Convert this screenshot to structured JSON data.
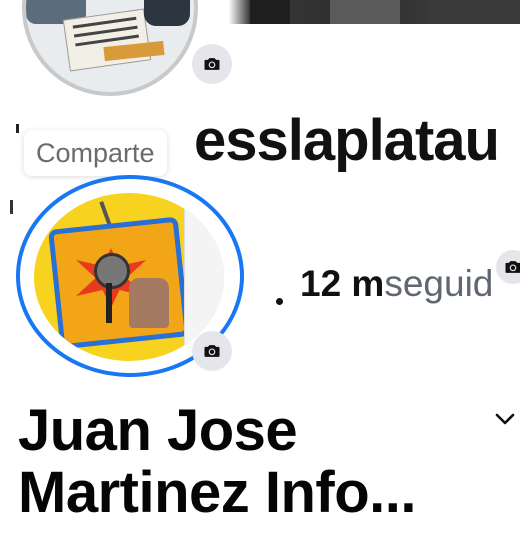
{
  "share_tooltip": {
    "label": "Comparte"
  },
  "page_username": "esslaplatau",
  "followers": {
    "count": "12 m",
    "label": "seguid"
  },
  "profile": {
    "display_name_line1": "Juan Jose",
    "display_name_line2": "Martinez Info..."
  },
  "icons": {
    "camera": "camera-icon",
    "chevron": "chevron-down-icon"
  },
  "colors": {
    "accent_ring": "#1877f2",
    "text_primary": "#050505",
    "text_secondary": "#606770"
  }
}
